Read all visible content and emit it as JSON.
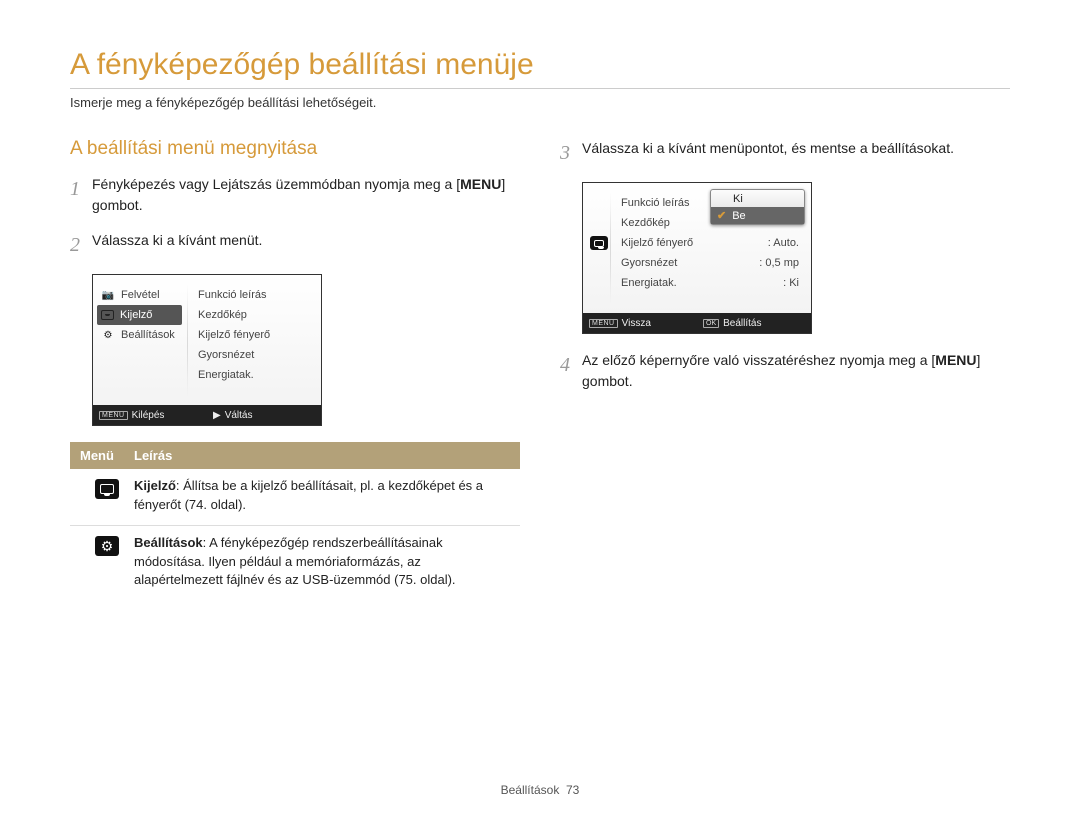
{
  "page": {
    "title": "A fényképezőgép beállítási menüje",
    "subtitle": "Ismerje meg a fényképezőgép beállítási lehetőségeit."
  },
  "section": {
    "opening_title": "A beállítási menü megnyitása"
  },
  "steps": {
    "s1": {
      "num": "1",
      "text_a": "Fényképezés vagy Lejátszás üzemmódban nyomja meg a [",
      "menu": "MENU",
      "text_b": "] gombot."
    },
    "s2": {
      "num": "2",
      "text": "Válassza ki a kívánt menüt."
    },
    "s3": {
      "num": "3",
      "text": "Válassza ki a kívánt menüpontot, és mentse a beállításokat."
    },
    "s4": {
      "num": "4",
      "text_a": "Az előző képernyőre való visszatéréshez nyomja meg a [",
      "menu": "MENU",
      "text_b": "] gombot."
    }
  },
  "shot1": {
    "left": {
      "felvetel": "Felvétel",
      "kijelzo": "Kijelző",
      "beallitasok": "Beállítások"
    },
    "right": {
      "r0": "Funkció leírás",
      "r1": "Kezdőkép",
      "r2": "Kijelző fényerő",
      "r3": "Gyorsnézet",
      "r4": "Energiatak."
    },
    "foot": {
      "menu_tag": "MENU",
      "left": "Kilépés",
      "arrow": "▶",
      "right": "Váltás"
    }
  },
  "shot2": {
    "rows": {
      "r0": {
        "k": "Funkció leírás",
        "v": ""
      },
      "r1": {
        "k": "Kezdőkép",
        "v": ""
      },
      "r2": {
        "k": "Kijelző fényerő",
        "v": ": Auto."
      },
      "r3": {
        "k": "Gyorsnézet",
        "v": ": 0,5 mp"
      },
      "r4": {
        "k": "Energiatak.",
        "v": ": Ki"
      }
    },
    "popup": {
      "opt0": "Ki",
      "opt1": "Be"
    },
    "foot": {
      "menu_tag": "MENU",
      "left": "Vissza",
      "ok_tag": "OK",
      "right": "Beállítás"
    }
  },
  "table": {
    "head": {
      "c1": "Menü",
      "c2": "Leírás"
    },
    "row1": {
      "bold": "Kijelző",
      "text": ": Állítsa be a kijelző beállításait, pl. a kezdőképet és a fényerőt (74. oldal)."
    },
    "row2": {
      "bold": "Beállítások",
      "text": ": A fényképezőgép rendszerbeállításainak módosítása. Ilyen például a memóriaformázás, az alapértelmezett fájlnév és az USB-üzemmód (75. oldal)."
    }
  },
  "footer": {
    "label": "Beállítások",
    "page": "73"
  }
}
